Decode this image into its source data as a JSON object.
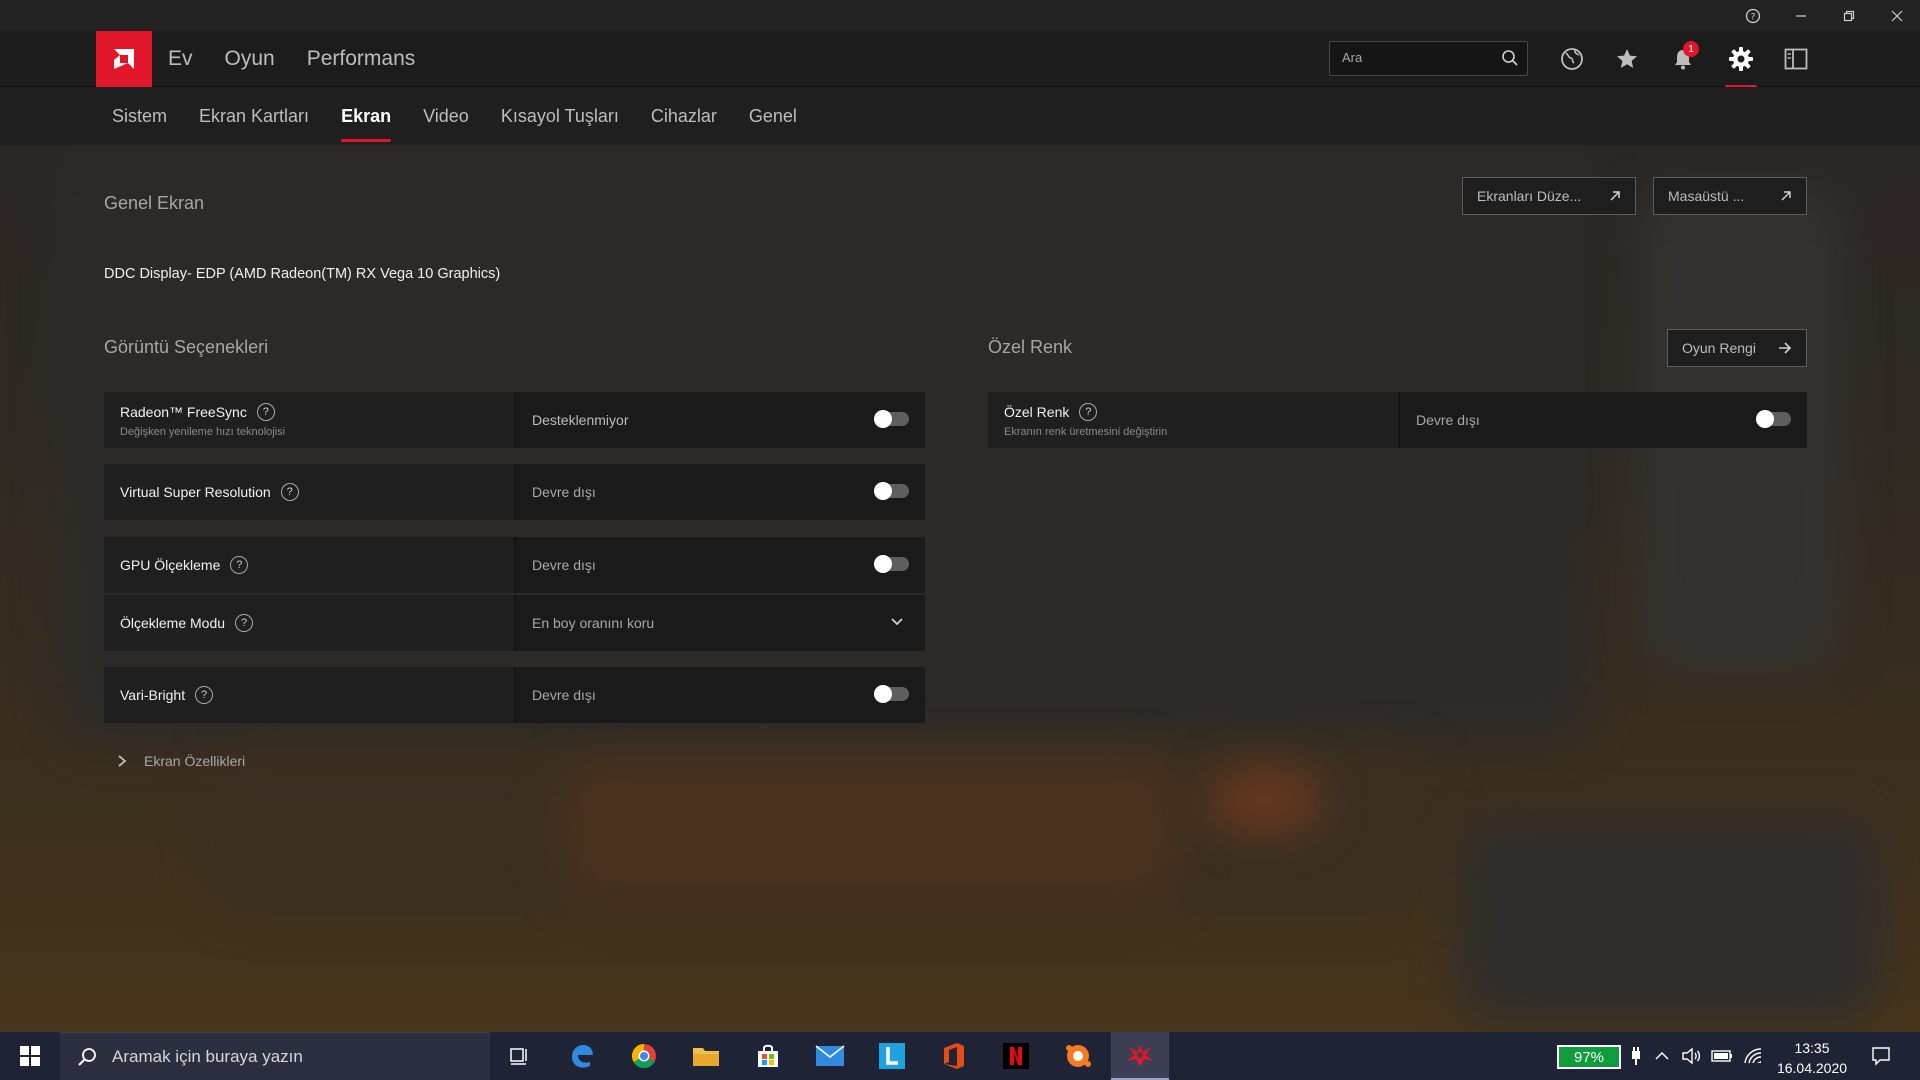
{
  "header": {
    "nav": [
      "Ev",
      "Oyun",
      "Performans"
    ],
    "search_placeholder": "Ara",
    "notification_count": "1"
  },
  "subnav": {
    "tabs": [
      "Sistem",
      "Ekran Kartları",
      "Ekran",
      "Video",
      "Kısayol Tuşları",
      "Cihazlar",
      "Genel"
    ],
    "active": "Ekran"
  },
  "general": {
    "title": "Genel Ekran",
    "display_name": "DDC Display- EDP (AMD Radeon(TM) RX Vega 10 Graphics)",
    "btn_arrange": "Ekranları Düze...",
    "btn_desktop": "Masaüstü ..."
  },
  "options": {
    "title": "Görüntü Seçenekleri",
    "freesync": {
      "label": "Radeon™ FreeSync",
      "sub": "Değişken yenileme hızı teknolojisi",
      "value": "Desteklenmiyor"
    },
    "vsr": {
      "label": "Virtual Super Resolution",
      "value": "Devre dışı"
    },
    "gpu_scaling": {
      "label": "GPU Ölçekleme",
      "value": "Devre dışı"
    },
    "scaling_mode": {
      "label": "Ölçekleme Modu",
      "value": "En boy oranını koru"
    },
    "vari_bright": {
      "label": "Vari-Bright",
      "value": "Devre dışı"
    }
  },
  "custom_color": {
    "title": "Özel Renk",
    "btn_game_color": "Oyun Rengi",
    "row": {
      "label": "Özel Renk",
      "sub": "Ekranın renk üretmesini değiştirin",
      "value": "Devre dışı"
    }
  },
  "expander": {
    "label": "Ekran Özellikleri"
  },
  "taskbar": {
    "search_placeholder": "Aramak için buraya yazın",
    "battery": "97%",
    "time": "13:35",
    "date": "16.04.2020"
  },
  "colors": {
    "accent": "#e1162b",
    "battery": "#0f9d3b"
  }
}
